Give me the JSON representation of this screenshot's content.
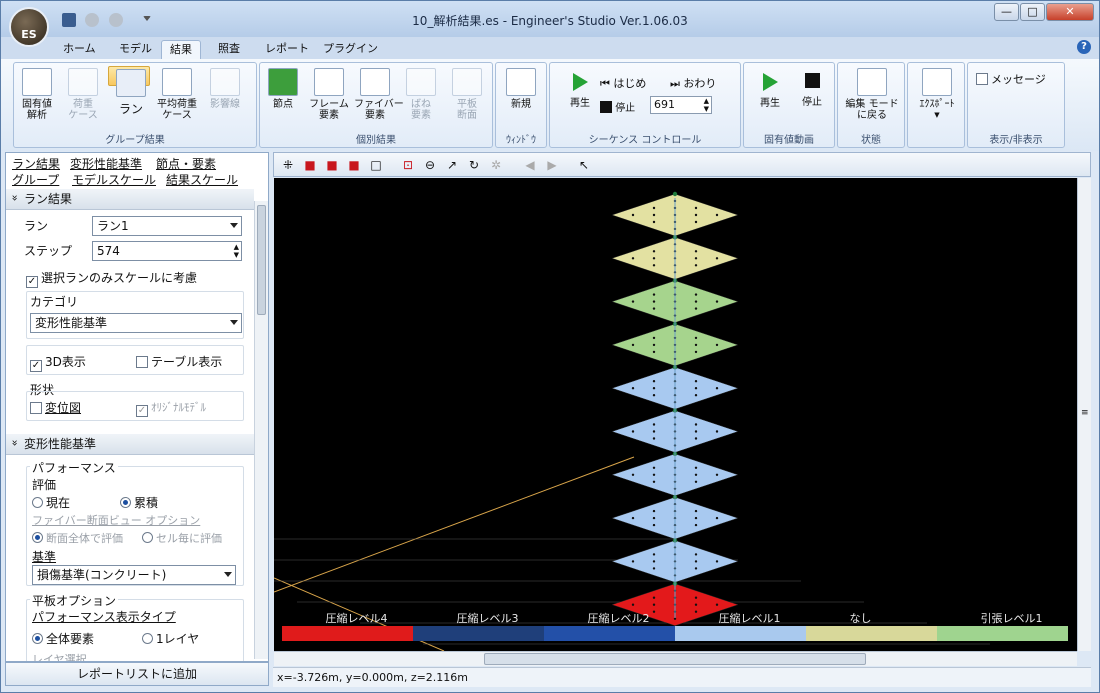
{
  "app": {
    "title": "10_解析結果.es - Engineer's Studio Ver.1.06.03",
    "logo_text": "ES"
  },
  "window_buttons": {
    "minimize": "—",
    "restore": "□",
    "close": "✕"
  },
  "tabs": [
    {
      "label": "ホーム"
    },
    {
      "label": "モデル"
    },
    {
      "label": "結果"
    },
    {
      "label": "照査"
    },
    {
      "label": "レポート"
    },
    {
      "label": "プラグイン"
    }
  ],
  "help": "?",
  "ribbon": {
    "group_result": {
      "caption": "グループ結果",
      "buttons": [
        "固有値\n解析",
        "荷重\nケース",
        "ラン",
        "平均荷重\nケース",
        "影響線"
      ]
    },
    "group_individual": {
      "caption": "個別結果",
      "buttons": [
        "節点",
        "フレーム\n要素",
        "ファイバー\n要素",
        "ばね\n要素",
        "平板\n断面"
      ]
    },
    "group_window": {
      "caption": "ｳｨﾝﾄﾞｳ",
      "new_label": "新規"
    },
    "group_sequence": {
      "caption": "シーケンス コントロール",
      "play": "再生",
      "start": "はじめ",
      "end": "おわり",
      "stop": "停止",
      "frame": "691"
    },
    "group_eigen": {
      "caption": "固有値動画",
      "play": "再生",
      "stop": "停止"
    },
    "group_state": {
      "caption": "状態",
      "label": "編集 モード\nに戻る"
    },
    "group_export": {
      "label": "ｴｸｽﾎﾟｰﾄ"
    },
    "group_display": {
      "caption": "表示/非表示",
      "message": "メッセージ"
    }
  },
  "left": {
    "links": [
      "ラン結果",
      "変形性能基準",
      "節点・要素",
      "グループ",
      "モデルスケール",
      "結果スケール"
    ],
    "sec_run": "ラン結果",
    "run_label": "ラン",
    "run_value": "ラン1",
    "step_label": "ステップ",
    "step_value": "574",
    "scale_cb": "選択ランのみスケールに考慮",
    "category_label": "カテゴリ",
    "category_value": "変形性能基準",
    "cb_3d": "3D表示",
    "cb_table": "テーブル表示",
    "shape_label": "形状",
    "cb_deform": "変位図",
    "cb_orig": "ｵﾘｼﾞﾅﾙﾓﾃﾞﾙ",
    "sec_deform": "変形性能基準",
    "perf": "パフォーマンス",
    "eval": "評価",
    "r_now": "現在",
    "r_acc": "累積",
    "fiber_opt": "ファイバー断面ビュー オプション",
    "r_whole": "断面全体で評価",
    "r_cell": "セル毎に評価",
    "basis": "基準",
    "basis_value": "損傷基準(コンクリート)",
    "plate_opt": "平板オプション",
    "perf_type": "パフォーマンス表示タイプ",
    "r_all": "全体要素",
    "r_layer": "1レイヤ",
    "layer_sel": "レイヤ選択"
  },
  "report_button": "レポートリストに追加",
  "legend": [
    {
      "label": "圧縮レベル4",
      "color": "#e01b1b"
    },
    {
      "label": "圧縮レベル3",
      "color": "#1f3f7a"
    },
    {
      "label": "圧縮レベル2",
      "color": "#2350a8"
    },
    {
      "label": "圧縮レベル1",
      "color": "#a9c9ee"
    },
    {
      "label": "なし",
      "color": "#d8d89a"
    },
    {
      "label": "引張レベル1",
      "color": "#9fd48f"
    }
  ],
  "plates": [
    {
      "level": "なし",
      "color": "#e3e1a2"
    },
    {
      "level": "なし",
      "color": "#e3e1a2"
    },
    {
      "level": "引張レベル1",
      "color": "#a6d48d"
    },
    {
      "level": "引張レベル1",
      "color": "#a6d48d"
    },
    {
      "level": "圧縮レベル1",
      "color": "#a8c9f0"
    },
    {
      "level": "圧縮レベル1",
      "color": "#a8c9f0"
    },
    {
      "level": "圧縮レベル1",
      "color": "#a8c9f0"
    },
    {
      "level": "圧縮レベル1",
      "color": "#a8c9f0"
    },
    {
      "level": "圧縮レベル1",
      "color": "#a8c9f0"
    },
    {
      "level": "圧縮レベル4",
      "color": "#e3191b"
    }
  ],
  "status": "x=-3.726m, y=0.000m, z=2.116m"
}
